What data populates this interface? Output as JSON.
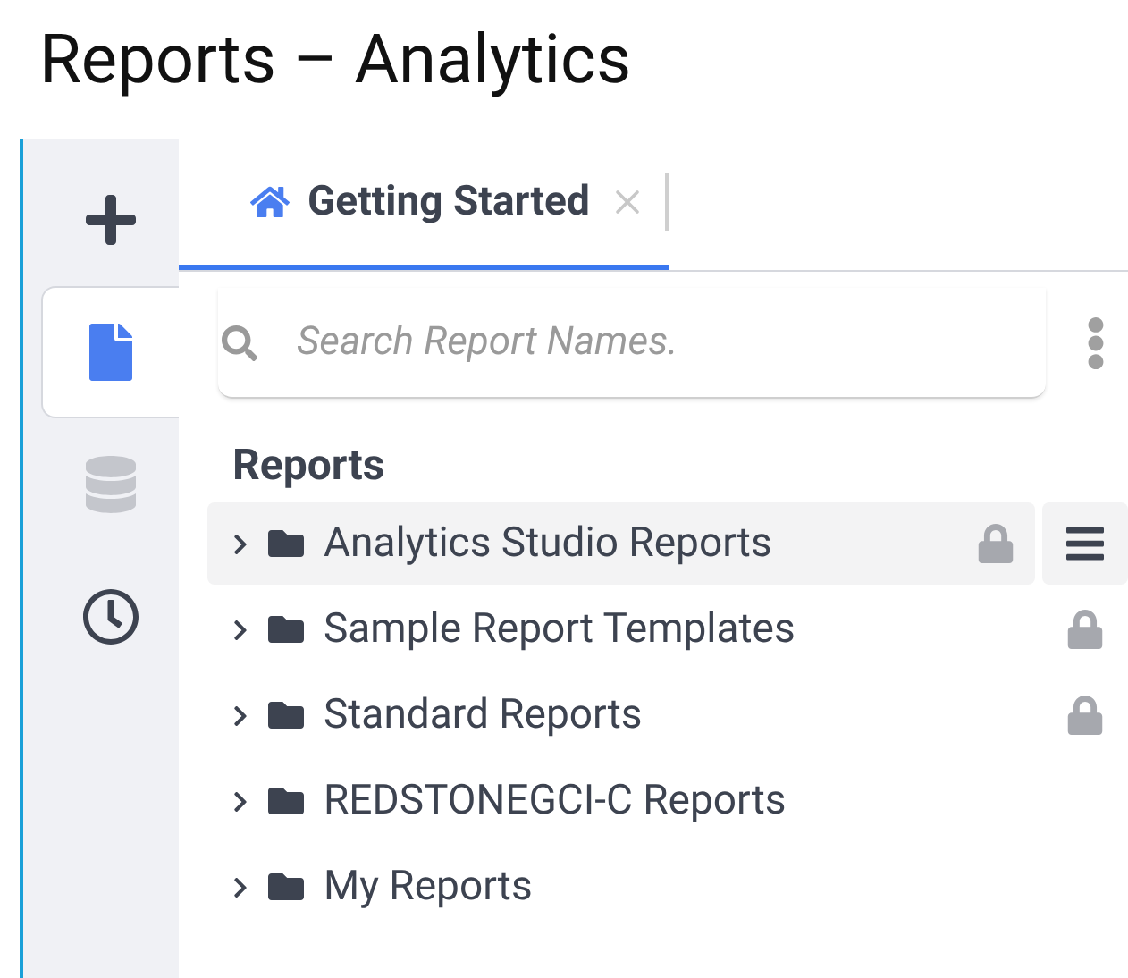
{
  "window": {
    "title": "Reports – Analytics"
  },
  "sidebar": {
    "items": [
      {
        "kind": "add",
        "selected": false,
        "disabled": false
      },
      {
        "kind": "reports",
        "selected": true,
        "disabled": false
      },
      {
        "kind": "data",
        "selected": false,
        "disabled": true
      },
      {
        "kind": "history",
        "selected": false,
        "disabled": false
      }
    ]
  },
  "tabs": [
    {
      "label": "Getting Started",
      "selected": true
    }
  ],
  "search": {
    "placeholder": "Search Report Names."
  },
  "tree": {
    "heading": "Reports",
    "items": [
      {
        "label": "Analytics Studio Reports",
        "locked": true,
        "selected": true
      },
      {
        "label": "Sample Report Templates",
        "locked": true,
        "selected": false
      },
      {
        "label": "Standard Reports",
        "locked": true,
        "selected": false
      },
      {
        "label": "REDSTONEGCI-C Reports",
        "locked": false,
        "selected": false
      },
      {
        "label": "My Reports",
        "locked": false,
        "selected": false
      }
    ]
  }
}
